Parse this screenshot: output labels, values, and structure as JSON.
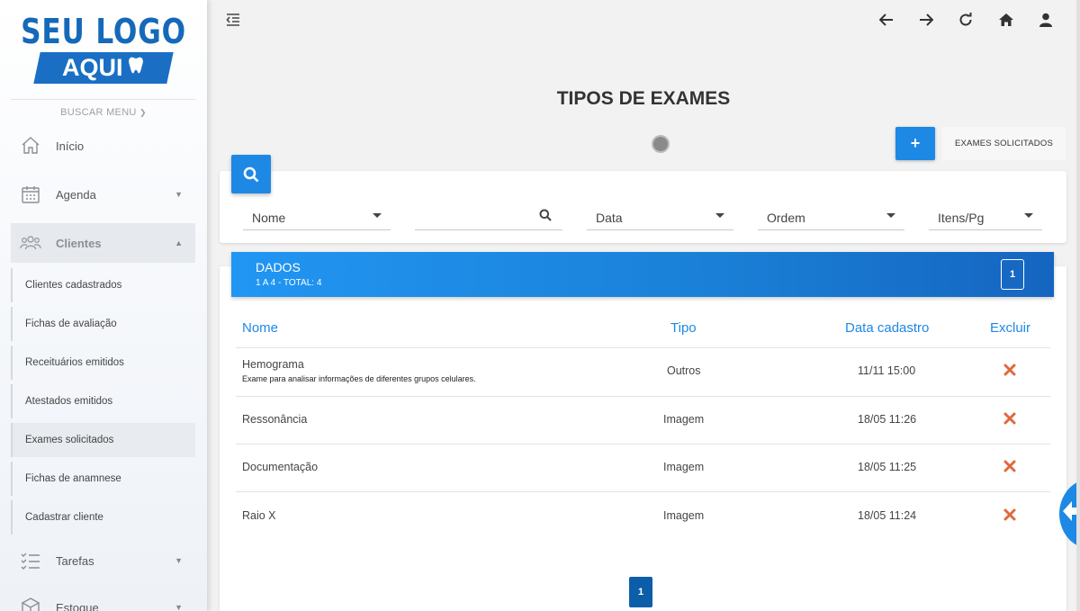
{
  "logo": {
    "line1": "SEU LOGO",
    "line2": "AQUI"
  },
  "sidebar": {
    "search_menu": "BUSCAR MENU",
    "items": [
      {
        "label": "Início",
        "icon": "home-icon"
      },
      {
        "label": "Agenda",
        "icon": "calendar-icon"
      },
      {
        "label": "Clientes",
        "icon": "users-icon"
      },
      {
        "label": "Tarefas",
        "icon": "checklist-icon"
      },
      {
        "label": "Estoque",
        "icon": "box-icon"
      }
    ],
    "sub_items": [
      "Clientes cadastrados",
      "Fichas de avaliação",
      "Receituários emitidos",
      "Atestados emitidos",
      "Exames solicitados",
      "Fichas de anamnese",
      "Cadastrar cliente"
    ]
  },
  "topbar": {
    "icons": [
      "menu-collapse-icon",
      "arrow-left-icon",
      "arrow-right-icon",
      "refresh-icon",
      "home-icon",
      "user-icon"
    ]
  },
  "page": {
    "title": "TIPOS DE EXAMES",
    "add_label": "+",
    "exames_button": "EXAMES SOLICITADOS"
  },
  "filters": {
    "name_select": "Nome",
    "search_value": "",
    "date_select": "Data",
    "order_select": "Ordem",
    "items_per_page_select": "Itens/Pg"
  },
  "data": {
    "title": "DADOS",
    "summary": "1 A 4 - TOTAL: 4",
    "current_page": "1",
    "columns": [
      "Nome",
      "Tipo",
      "Data cadastro",
      "Excluir"
    ],
    "rows": [
      {
        "nome": "Hemograma",
        "descricao": "Exame para analisar informações de diferentes grupos celulares.",
        "tipo": "Outros",
        "data": "11/11 15:00"
      },
      {
        "nome": "Ressonância",
        "descricao": "",
        "tipo": "Imagem",
        "data": "18/05 11:26"
      },
      {
        "nome": "Documentação",
        "descricao": "",
        "tipo": "Imagem",
        "data": "18/05 11:25"
      },
      {
        "nome": "Raio X",
        "descricao": "",
        "tipo": "Imagem",
        "data": "18/05 11:24"
      }
    ]
  },
  "pagination": {
    "page": "1"
  },
  "colors": {
    "primary": "#1e88e5",
    "dark_primary": "#0d5ea8",
    "delete": "#e0683c",
    "logo_blue": "#1569b9"
  }
}
